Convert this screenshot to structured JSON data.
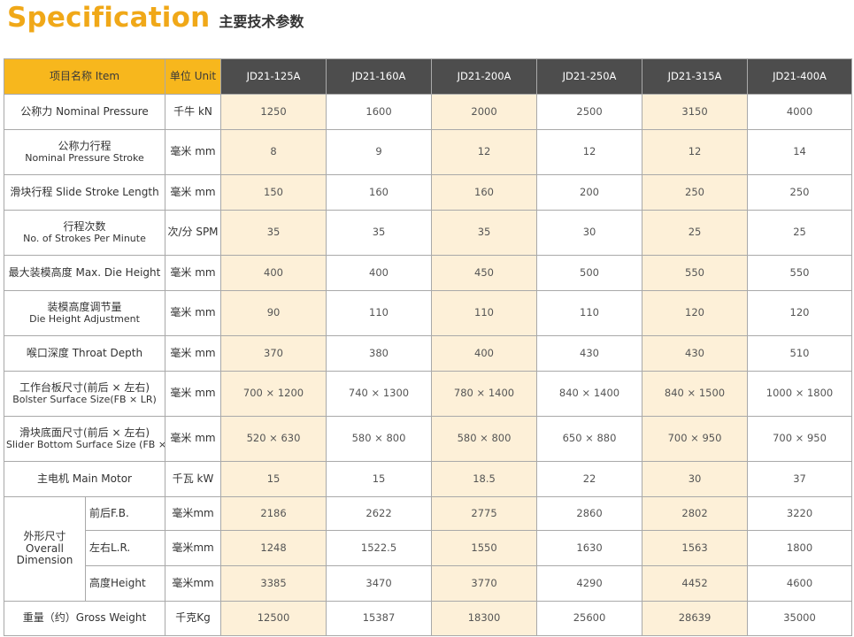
{
  "header": {
    "title_en": "Specification",
    "title_cn": "主要技术参数"
  },
  "colors": {
    "accent": "#f7b71d",
    "model_header_bg": "#4d4d4d",
    "highlight_col": "#fdf0d8",
    "border": "#a9a9a9"
  },
  "table": {
    "header": {
      "item": "项目名称 Item",
      "unit": "单位 Unit",
      "models": [
        "JD21-125A",
        "JD21-160A",
        "JD21-200A",
        "JD21-250A",
        "JD21-315A",
        "JD21-400A"
      ]
    },
    "rows": {
      "r0": {
        "name": "公称力 Nominal Pressure",
        "unit": "千牛 kN",
        "values": [
          "1250",
          "1600",
          "2000",
          "2500",
          "3150",
          "4000"
        ]
      },
      "r1": {
        "name_cn": "公称力行程",
        "name_en": "Nominal Pressure Stroke",
        "unit": "毫米 mm",
        "values": [
          "8",
          "9",
          "12",
          "12",
          "12",
          "14"
        ]
      },
      "r2": {
        "name": "滑块行程 Slide Stroke Length",
        "unit": "毫米 mm",
        "values": [
          "150",
          "160",
          "160",
          "200",
          "250",
          "250"
        ]
      },
      "r3": {
        "name_cn": "行程次数",
        "name_en": "No. of Strokes Per Minute",
        "unit": "次/分 SPM",
        "values": [
          "35",
          "35",
          "35",
          "30",
          "25",
          "25"
        ]
      },
      "r4": {
        "name": "最大装模高度 Max. Die Height",
        "unit": "毫米 mm",
        "values": [
          "400",
          "400",
          "450",
          "500",
          "550",
          "550"
        ]
      },
      "r5": {
        "name_cn": "装模高度调节量",
        "name_en": "Die Height Adjustment",
        "unit": "毫米 mm",
        "values": [
          "90",
          "110",
          "110",
          "110",
          "120",
          "120"
        ]
      },
      "r6": {
        "name": "喉口深度 Throat Depth",
        "unit": "毫米 mm",
        "values": [
          "370",
          "380",
          "400",
          "430",
          "430",
          "510"
        ]
      },
      "r7": {
        "name_cn": "工作台板尺寸(前后 × 左右)",
        "name_en": "Bolster Surface Size(FB × LR)",
        "unit": "毫米 mm",
        "values": [
          "700 × 1200",
          "740 × 1300",
          "780 × 1400",
          "840 × 1400",
          "840 × 1500",
          "1000 × 1800"
        ]
      },
      "r8": {
        "name_cn": "滑块底面尺寸(前后 × 左右)",
        "name_en": "Slider Bottom Surface Size (FB × LR)",
        "unit": "毫米 mm",
        "values": [
          "520 × 630",
          "580 × 800",
          "580 × 800",
          "650 × 880",
          "700 × 950",
          "700 × 950"
        ]
      },
      "r9": {
        "name": "主电机 Main Motor",
        "unit": "千瓦 kW",
        "values": [
          "15",
          "15",
          "18.5",
          "22",
          "30",
          "37"
        ]
      },
      "dim": {
        "group_cn": "外形尺寸",
        "group_en1": "Overall",
        "group_en2": "Dimension",
        "fb": {
          "sub": "前后F.B.",
          "unit": "毫米mm",
          "values": [
            "2186",
            "2622",
            "2775",
            "2860",
            "2802",
            "3220"
          ]
        },
        "lr": {
          "sub": "左右L.R.",
          "unit": "毫米mm",
          "values": [
            "1248",
            "1522.5",
            "1550",
            "1630",
            "1563",
            "1800"
          ]
        },
        "h": {
          "sub": "高度Height",
          "unit": "毫米mm",
          "values": [
            "3385",
            "3470",
            "3770",
            "4290",
            "4452",
            "4600"
          ]
        }
      },
      "r13": {
        "name": "重量（约）Gross Weight",
        "unit": "千克Kg",
        "values": [
          "12500",
          "15387",
          "18300",
          "25600",
          "28639",
          "35000"
        ]
      }
    }
  }
}
